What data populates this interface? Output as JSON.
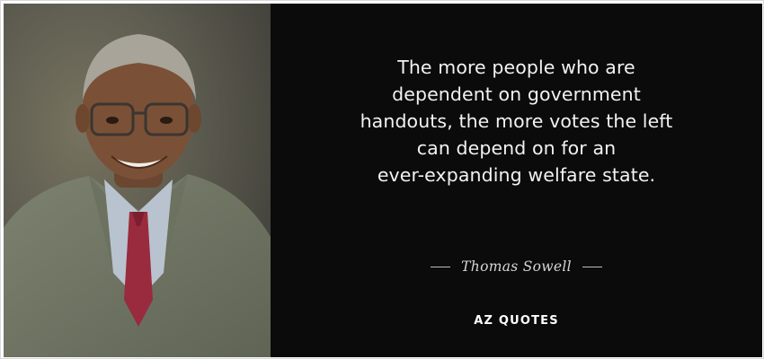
{
  "quote": {
    "lines": [
      "The more people who are",
      "dependent on government",
      "handouts, the more votes the left",
      "can depend on for an",
      "ever-expanding welfare state."
    ]
  },
  "author": "Thomas Sowell",
  "brand": "AZ QUOTES",
  "colors": {
    "quote_background": "#0b0b0b",
    "quote_text": "#f2f2f2",
    "frame": "#ffffff"
  }
}
